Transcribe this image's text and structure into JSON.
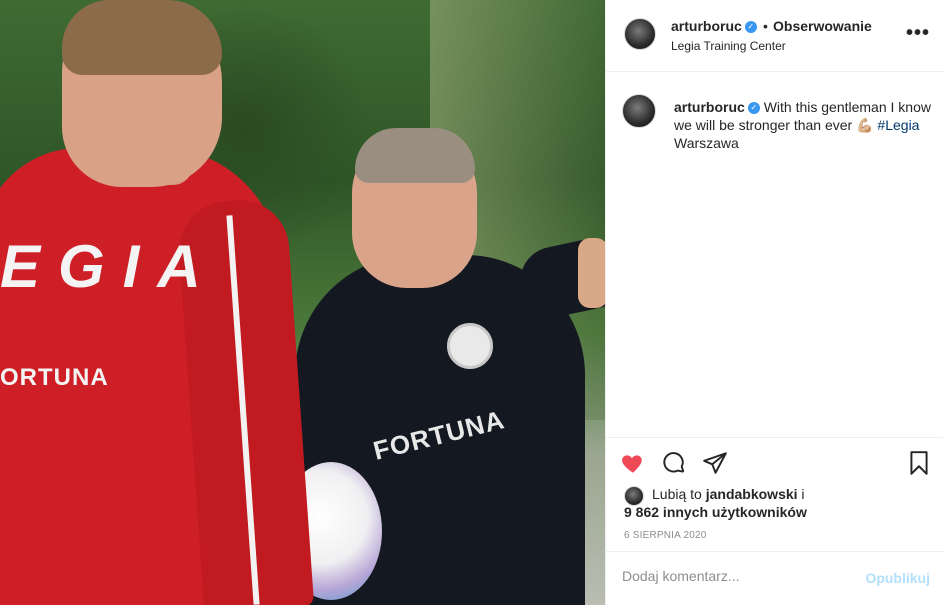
{
  "post": {
    "username": "arturboruc",
    "follow_label": "Obserwowanie",
    "location": "Legia Training Center",
    "caption": "With this gentleman I know we will be stronger than ever",
    "caption_emoji": "💪🏼",
    "hashtag": "#Legia",
    "caption_end": "Warszawa",
    "likes_prefix": "Lubią to",
    "likes_user": "jandabkowski",
    "likes_suffix": "i",
    "likes_others": "9 862 innych użytkowników",
    "date": "6 SIERPNIA 2020",
    "comment_placeholder": "Dodaj komentarz...",
    "publish_label": "Opublikuj"
  },
  "photo": {
    "player_text_top": "EGIA",
    "player_text_bottom": "ORTUNA",
    "coach_text": "FORTUNA"
  },
  "colors": {
    "like": "#ed4956",
    "verified": "#3897f0",
    "link": "#00376b",
    "publish_disabled": "#b2dffc"
  }
}
